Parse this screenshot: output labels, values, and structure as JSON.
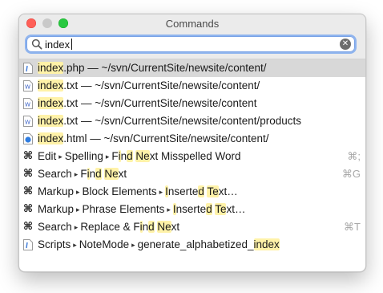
{
  "window": {
    "title": "Commands"
  },
  "search": {
    "value": "index",
    "placeholder": ""
  },
  "icons": {
    "search": "magnifier-icon",
    "clear": "clear-icon",
    "php": "php-file-icon",
    "txt": "text-file-icon",
    "html": "html-file-icon",
    "command": "command-key-icon",
    "script": "script-file-icon"
  },
  "results": [
    {
      "kind": "file",
      "icon": "php",
      "selected": true,
      "parts": [
        [
          "index",
          true
        ],
        [
          ".php — ~/svn/CurrentSite/newsite/content/",
          false
        ]
      ],
      "shortcut": ""
    },
    {
      "kind": "file",
      "icon": "txt",
      "selected": false,
      "parts": [
        [
          "index",
          true
        ],
        [
          ".txt — ~/svn/CurrentSite/newsite/content/",
          false
        ]
      ],
      "shortcut": ""
    },
    {
      "kind": "file",
      "icon": "txt",
      "selected": false,
      "parts": [
        [
          "index",
          true
        ],
        [
          ".txt — ~/svn/CurrentSite/newsite/content",
          false
        ]
      ],
      "shortcut": ""
    },
    {
      "kind": "file",
      "icon": "txt",
      "selected": false,
      "parts": [
        [
          "index",
          true
        ],
        [
          ".txt — ~/svn/CurrentSite/newsite/content/products",
          false
        ]
      ],
      "shortcut": ""
    },
    {
      "kind": "file",
      "icon": "html",
      "selected": false,
      "parts": [
        [
          "index",
          true
        ],
        [
          ".html — ~/svn/CurrentSite/newsite/content/",
          false
        ]
      ],
      "shortcut": ""
    },
    {
      "kind": "command",
      "icon": "command",
      "selected": false,
      "parts": [
        [
          "Edit",
          false
        ],
        [
          "▸",
          "arrow"
        ],
        [
          "Spelling",
          false
        ],
        [
          "▸",
          "arrow"
        ],
        [
          "F",
          false
        ],
        [
          "i",
          true
        ],
        [
          "n",
          false
        ],
        [
          "d",
          true
        ],
        [
          " ",
          false
        ],
        [
          "Ne",
          true
        ],
        [
          "x",
          false
        ],
        [
          "t",
          false
        ],
        [
          " Misspelled Word",
          false
        ]
      ],
      "shortcut": "⌘;"
    },
    {
      "kind": "command",
      "icon": "command",
      "selected": false,
      "parts": [
        [
          "Search",
          false
        ],
        [
          "▸",
          "arrow"
        ],
        [
          "F",
          false
        ],
        [
          "i",
          true
        ],
        [
          "n",
          false
        ],
        [
          "d",
          true
        ],
        [
          " ",
          false
        ],
        [
          "Ne",
          true
        ],
        [
          "xt",
          false
        ]
      ],
      "shortcut": "⌘G"
    },
    {
      "kind": "command",
      "icon": "command",
      "selected": false,
      "parts": [
        [
          "Markup",
          false
        ],
        [
          "▸",
          "arrow"
        ],
        [
          "Block Elements",
          false
        ],
        [
          "▸",
          "arrow"
        ],
        [
          "I",
          true
        ],
        [
          "nserte",
          false
        ],
        [
          "d",
          true
        ],
        [
          " ",
          false
        ],
        [
          "Te",
          true
        ],
        [
          "x",
          false
        ],
        [
          "t…",
          false
        ]
      ],
      "shortcut": ""
    },
    {
      "kind": "command",
      "icon": "command",
      "selected": false,
      "parts": [
        [
          "Markup",
          false
        ],
        [
          "▸",
          "arrow"
        ],
        [
          "Phrase Elements",
          false
        ],
        [
          "▸",
          "arrow"
        ],
        [
          "I",
          true
        ],
        [
          "nserte",
          false
        ],
        [
          "d",
          true
        ],
        [
          " ",
          false
        ],
        [
          "Te",
          true
        ],
        [
          "x",
          false
        ],
        [
          "t…",
          false
        ]
      ],
      "shortcut": ""
    },
    {
      "kind": "command",
      "icon": "command",
      "selected": false,
      "parts": [
        [
          "Search",
          false
        ],
        [
          "▸",
          "arrow"
        ],
        [
          "Replace & F",
          false
        ],
        [
          "i",
          true
        ],
        [
          "n",
          false
        ],
        [
          "d",
          true
        ],
        [
          " ",
          false
        ],
        [
          "Ne",
          true
        ],
        [
          "x",
          false
        ],
        [
          "t",
          false
        ]
      ],
      "shortcut": "⌘T"
    },
    {
      "kind": "script",
      "icon": "script",
      "selected": false,
      "parts": [
        [
          "Scripts",
          false
        ],
        [
          "▸",
          "arrow"
        ],
        [
          "NoteMode",
          false
        ],
        [
          "▸",
          "arrow"
        ],
        [
          "generate_alphabetized_",
          false
        ],
        [
          "index",
          true
        ]
      ],
      "shortcut": ""
    }
  ],
  "colors": {
    "highlight": "#fff2a8",
    "selection": "#d8d8d8",
    "focus_ring": "#8fb4ee"
  }
}
